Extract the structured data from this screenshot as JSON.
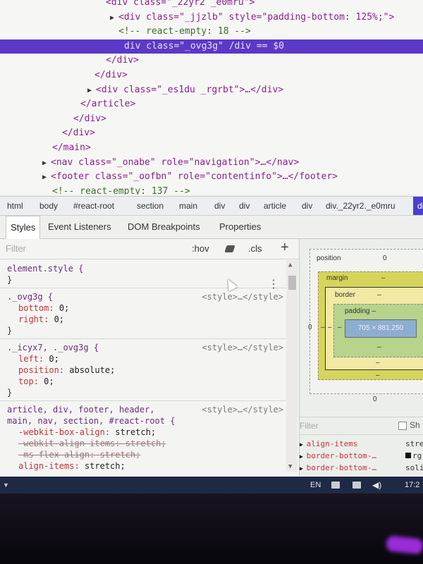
{
  "tree": {
    "lines": [
      {
        "tri": "",
        "open": "<div class=\"_22yr2 _e0mru\">",
        "kind": "partial"
      },
      {
        "tri": "▶",
        "open": "<div class=\"_jjzlb\" style=\"padding-bottom: 125%;\">",
        "kind": "node"
      },
      {
        "tri": "",
        "open": "<!-- react-empty: 18 -->",
        "kind": "comment"
      },
      {
        "tri": "",
        "open": "div  class=\"_ovg3g\"  /div  == $0",
        "kind": "selected"
      },
      {
        "tri": "",
        "open": "</div>",
        "kind": "node"
      },
      {
        "tri": "",
        "open": "</div>",
        "kind": "node"
      },
      {
        "tri": "▶",
        "open": "<div class=\"_es1du _rgrbt\">…</div>",
        "kind": "node"
      },
      {
        "tri": "",
        "open": "</article>",
        "kind": "node"
      },
      {
        "tri": "",
        "open": "</div>",
        "kind": "node"
      },
      {
        "tri": "",
        "open": "</div>",
        "kind": "node"
      },
      {
        "tri": "",
        "open": "</main>",
        "kind": "node"
      },
      {
        "tri": "▶",
        "open": "<nav class=\"_onabe\" role=\"navigation\">…</nav>",
        "kind": "node"
      },
      {
        "tri": "▶",
        "open": "<footer class=\"_oofbn\" role=\"contentinfo\">…</footer>",
        "kind": "node"
      },
      {
        "tri": "",
        "open": "<!-- react-empty: 137 -->",
        "kind": "comment"
      }
    ]
  },
  "breadcrumbs": [
    "html",
    "body",
    "#react-root",
    "section",
    "main",
    "div",
    "div",
    "article",
    "div",
    "div._22yr2._e0mru",
    "div"
  ],
  "subtabs": [
    "Styles",
    "Event Listeners",
    "DOM Breakpoints",
    "Properties"
  ],
  "styles": {
    "filter_placeholder": "Filter",
    "hov": ":hov",
    "cls": ".cls",
    "plus": "+",
    "rules": [
      {
        "selector": "element.style {",
        "source": "",
        "props": [],
        "close": "}"
      },
      {
        "selector": "._ovg3g {",
        "source": "<style>…</style>",
        "props": [
          {
            "name": "bottom",
            "value": "0;",
            "struck": false
          },
          {
            "name": "right",
            "value": "0;",
            "struck": false
          }
        ],
        "close": "}"
      },
      {
        "selector": "._icyx7, ._ovg3g {",
        "source": "<style>…</style>",
        "props": [
          {
            "name": "left",
            "value": "0;",
            "struck": false
          },
          {
            "name": "position",
            "value": "absolute;",
            "struck": false
          },
          {
            "name": "top",
            "value": "0;",
            "struck": false
          }
        ],
        "close": "}"
      },
      {
        "selector": "article, div, footer, header,",
        "selector2": "main, nav, section, #react-root {",
        "source": "<style>…</style>",
        "props": [
          {
            "name": "-webkit-box-align",
            "value": "stretch;",
            "struck": false
          },
          {
            "name": "-webkit-align-items",
            "value": "stretch;",
            "struck": true
          },
          {
            "name": "-ms-flex-align",
            "value": "stretch;",
            "struck": true
          },
          {
            "name": "align-items",
            "value": "stretch;",
            "struck": false
          }
        ],
        "close": ""
      }
    ]
  },
  "box_model": {
    "position_label": "position",
    "position_value": "0",
    "margin_label": "margin",
    "margin_value": "–",
    "border_label": "border",
    "border_value": "–",
    "padding_label": "padding –",
    "padding_bottom": "–",
    "content": "705 × 881.250",
    "left_outer": "0",
    "left_margin": "–",
    "left_border": "–",
    "left_padding": "–",
    "border_bottom": "–",
    "margin_bottom": "–",
    "position_bottom": "0"
  },
  "computed": {
    "filter_placeholder": "Filter",
    "show_label": "Sh",
    "rows": [
      {
        "prop": "align-items",
        "value": "stre"
      },
      {
        "prop": "border-bottom-…",
        "value": "rg",
        "swatch": true
      },
      {
        "prop": "border-bottom-…",
        "value": "soli"
      }
    ]
  },
  "taskbar": {
    "lang": "EN",
    "time": "17:2"
  },
  "colors": {
    "selection": "#5a39c6",
    "margin": "#d7d45b",
    "border": "#f2e9a4",
    "padding": "#b7d38c",
    "content": "#8eaecf",
    "taskbar": "#1e2a44"
  }
}
